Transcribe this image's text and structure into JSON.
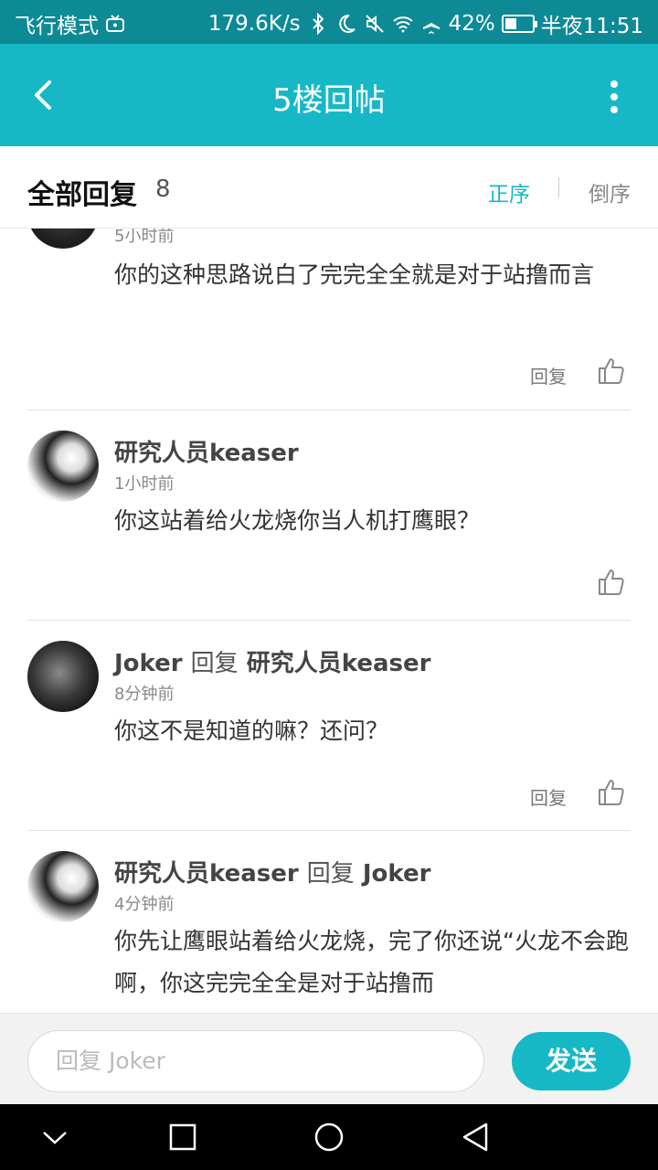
{
  "status_bar": {
    "carrier": "飞行模式",
    "speed": "179.6K/s",
    "battery": "42%",
    "battery_level": 0.42,
    "time": "半夜11:51"
  },
  "header": {
    "title": "5楼回帖"
  },
  "section": {
    "label": "全部回复",
    "count": "8",
    "sort_asc": "正序",
    "sort_desc": "倒序"
  },
  "replies": [
    {
      "time": "5小时前",
      "content": "你的这种思路说白了完完全全就是对于站撸而言",
      "reply_label": "回复"
    },
    {
      "author": "研究人员keaser",
      "time": "1小时前",
      "content": "你这站着给火龙烧你当人机打鹰眼？"
    },
    {
      "author": "Joker",
      "reply_word": "回复",
      "target": "研究人员keaser",
      "time": "8分钟前",
      "content": "你这不是知道的嘛？还问？",
      "reply_label": "回复"
    },
    {
      "author": "研究人员keaser",
      "reply_word": "回复",
      "target": "Joker",
      "time": "4分钟前",
      "content": "你先让鹰眼站着给火龙烧，完了你还说“火龙不会跑啊，你这完完全全是对于站撸而"
    }
  ],
  "input": {
    "placeholder": "回复 Joker",
    "send_label": "发送"
  },
  "colors": {
    "accent": "#16b8c6",
    "status_bar": "#0d8a96"
  }
}
